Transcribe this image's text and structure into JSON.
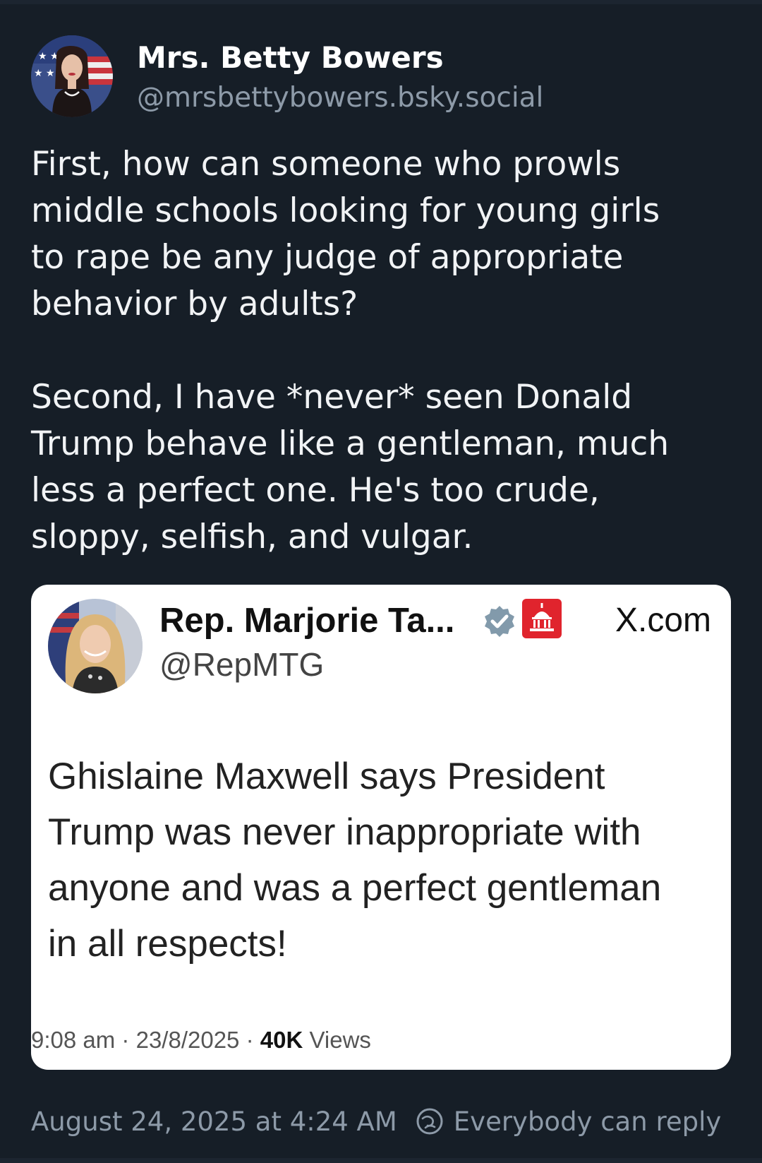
{
  "author": {
    "display_name": "Mrs. Betty Bowers",
    "handle": "@mrsbettybowers.bsky.social"
  },
  "post": {
    "paragraph_1_lines": [
      "First, how can someone who prowls",
      "middle schools looking for young girls",
      "to rape be any judge of appropriate",
      "behavior by adults?"
    ],
    "paragraph_2_lines": [
      "Second, I have *never* seen Donald",
      "Trump behave like a gentleman, much",
      "less a perfect one. He's too crude,",
      "sloppy, selfish, and vulgar."
    ]
  },
  "embed": {
    "display_name": "Rep. Marjorie Ta...",
    "handle": "@RepMTG",
    "source": "X.com",
    "text_lines": [
      "Ghislaine Maxwell says President",
      "Trump was never inappropriate with",
      "anyone and was a perfect gentleman",
      "in all respects!"
    ],
    "time": "9:08 am",
    "date": "23/8/2025",
    "views_count": "40K",
    "views_label": "Views",
    "separator": "·"
  },
  "footer": {
    "timestamp": "August 24, 2025 at 4:24 AM",
    "reply_setting": "Everybody can reply"
  },
  "colors": {
    "background": "#161e27",
    "primary_text": "#f1f3f5",
    "secondary_text": "#8d9aa8",
    "embed_background": "#ffffff",
    "verified_badge": "#829aab",
    "capitol_badge": "#e0242d"
  },
  "icons": {
    "author_avatar": "avatar-portrait-icon",
    "embed_avatar": "avatar-portrait-icon",
    "verified": "verified-badge-icon",
    "government": "capitol-building-icon",
    "reply": "everybody-reply-icon"
  }
}
